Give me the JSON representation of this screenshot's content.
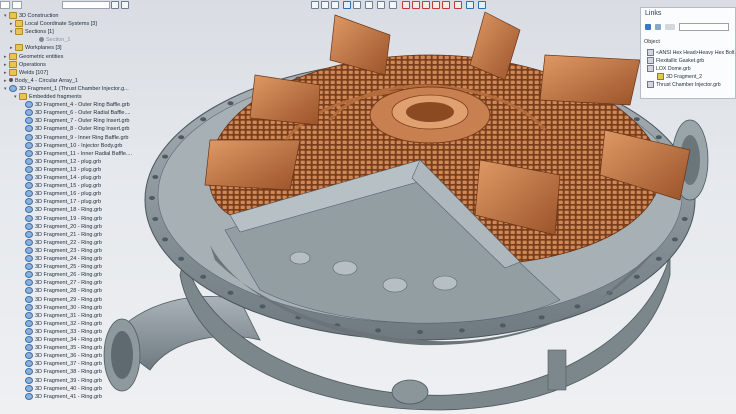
{
  "toolbar": {
    "search_value": ""
  },
  "tree": {
    "items": [
      {
        "label": "3D Construction",
        "exp": "▾",
        "icon": "folder"
      },
      {
        "label": "Local Coordinate Systems [3]",
        "exp": "▸",
        "icon": "folder"
      },
      {
        "label": "Sections [1]",
        "exp": "▾",
        "icon": "folder"
      },
      {
        "label": "Section_1",
        "exp": "",
        "icon": "eye",
        "dim": true
      },
      {
        "label": "Workplanes [3]",
        "exp": "▸",
        "icon": "folder"
      },
      {
        "label": "Geometric entities",
        "exp": "▸",
        "icon": "folder"
      },
      {
        "label": "Operations",
        "exp": "▸",
        "icon": "folder"
      },
      {
        "label": "Welds [107]",
        "exp": "▸",
        "icon": "folder"
      },
      {
        "label": "Body_4 - Circular Array_1",
        "exp": "▸",
        "icon": "blk"
      },
      {
        "label": "3D Fragment_1 (Thrust Chamber Injector.g...",
        "exp": "▾",
        "icon": "part"
      },
      {
        "label": "Embedded fragments",
        "exp": "▾",
        "icon": "folder"
      },
      {
        "label": "3D Fragment_4 - Outer Ring Baffle.grb",
        "icon": "part"
      },
      {
        "label": "3D Fragment_6 - Outer Radial Baffle....",
        "icon": "part"
      },
      {
        "label": "3D Fragment_7 - Outer Ring Insert.grb",
        "icon": "part"
      },
      {
        "label": "3D Fragment_8 - Outer Ring Insert.grb",
        "icon": "part"
      },
      {
        "label": "3D Fragment_9 - Inner Ring Baffle.grb",
        "icon": "part"
      },
      {
        "label": "3D Fragment_10 - Injector Body.grb",
        "icon": "part"
      },
      {
        "label": "3D Fragment_11 - Inner Radial Baffle....",
        "icon": "part"
      },
      {
        "label": "3D Fragment_12 - plug.grb",
        "icon": "part"
      },
      {
        "label": "3D Fragment_13 - plug.grb",
        "icon": "part"
      },
      {
        "label": "3D Fragment_14 - plug.grb",
        "icon": "part"
      },
      {
        "label": "3D Fragment_15 - plug.grb",
        "icon": "part"
      },
      {
        "label": "3D Fragment_16 - plug.grb",
        "icon": "part"
      },
      {
        "label": "3D Fragment_17 - plug.grb",
        "icon": "part"
      },
      {
        "label": "3D Fragment_18 - Ring.grb",
        "icon": "part"
      },
      {
        "label": "3D Fragment_19 - Ring.grb",
        "icon": "part"
      },
      {
        "label": "3D Fragment_20 - Ring.grb",
        "icon": "part"
      },
      {
        "label": "3D Fragment_21 - Ring.grb",
        "icon": "part"
      },
      {
        "label": "3D Fragment_22 - Ring.grb",
        "icon": "part"
      },
      {
        "label": "3D Fragment_23 - Ring.grb",
        "icon": "part"
      },
      {
        "label": "3D Fragment_24 - Ring.grb",
        "icon": "part"
      },
      {
        "label": "3D Fragment_25 - Ring.grb",
        "icon": "part"
      },
      {
        "label": "3D Fragment_26 - Ring.grb",
        "icon": "part"
      },
      {
        "label": "3D Fragment_27 - Ring.grb",
        "icon": "part"
      },
      {
        "label": "3D Fragment_28 - Ring.grb",
        "icon": "part"
      },
      {
        "label": "3D Fragment_29 - Ring.grb",
        "icon": "part"
      },
      {
        "label": "3D Fragment_30 - Ring.grb",
        "icon": "part"
      },
      {
        "label": "3D Fragment_31 - Ring.grb",
        "icon": "part"
      },
      {
        "label": "3D Fragment_32 - Ring.grb",
        "icon": "part"
      },
      {
        "label": "3D Fragment_33 - Ring.grb",
        "icon": "part"
      },
      {
        "label": "3D Fragment_34 - Ring.grb",
        "icon": "part"
      },
      {
        "label": "3D Fragment_35 - Ring.grb",
        "icon": "part"
      },
      {
        "label": "3D Fragment_36 - Ring.grb",
        "icon": "part"
      },
      {
        "label": "3D Fragment_37 - Ring.grb",
        "icon": "part"
      },
      {
        "label": "3D Fragment_38 - Ring.grb",
        "icon": "part"
      },
      {
        "label": "3D Fragment_39 - Ring.grb",
        "icon": "part"
      },
      {
        "label": "3D Fragment_40 - Ring.grb",
        "icon": "part"
      },
      {
        "label": "3D Fragment_41 - Ring.grb",
        "icon": "part"
      }
    ]
  },
  "links": {
    "title": "Links",
    "object_label": "Object",
    "items": [
      "<ANSI Hex Head>Heavy Hex Bolt All",
      "Flexitallic Gasket.grb",
      "LOX Dome.grb",
      "3D Fragment_2",
      "Thrust Chamber Injector.grb"
    ]
  },
  "colors": {
    "copper": "#c77b47",
    "steel": "#8d989d",
    "panel_bg": "#fbfcfd",
    "selection": "#c9dcf2"
  }
}
